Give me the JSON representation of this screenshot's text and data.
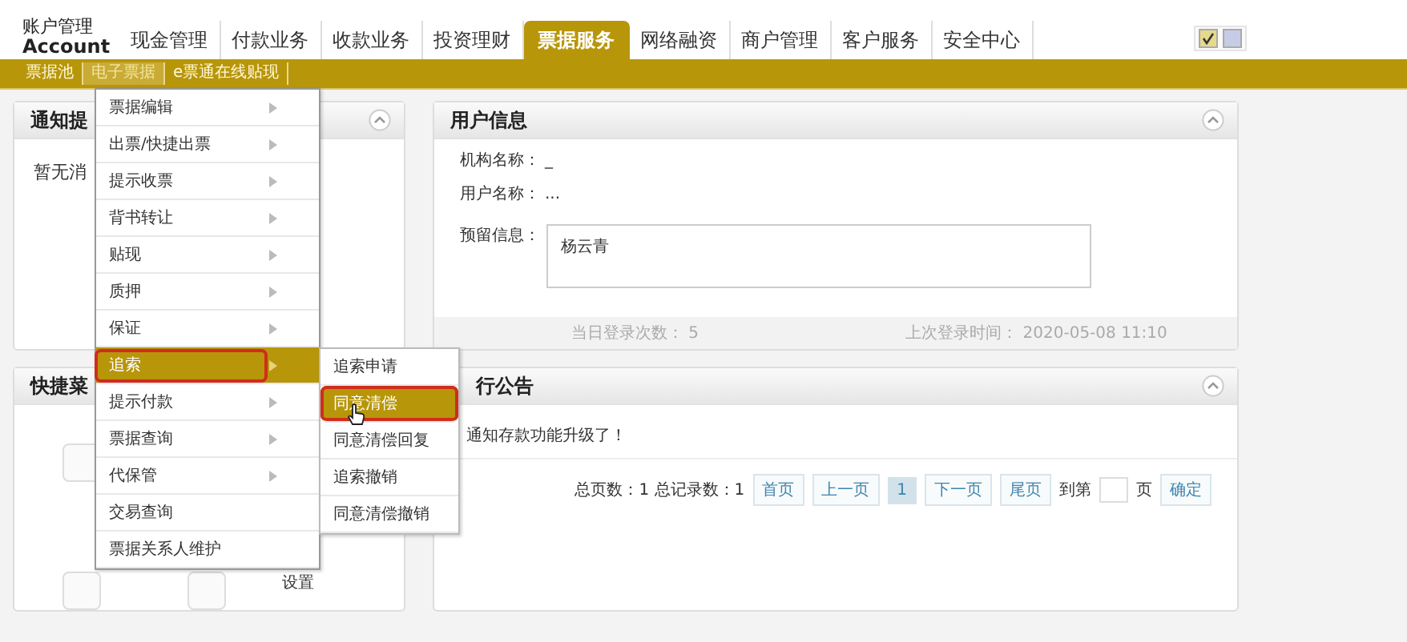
{
  "header": {
    "logo_lines": [
      "账户管理",
      "Account"
    ],
    "theme_swatches": [
      {
        "color": "#e6d98c",
        "selected": true
      },
      {
        "color": "#c6cbe6",
        "selected": false
      }
    ]
  },
  "nav_tabs": [
    {
      "label": "现金管理",
      "selected": false
    },
    {
      "label": "付款业务",
      "selected": false
    },
    {
      "label": "收款业务",
      "selected": false
    },
    {
      "label": "投资理财",
      "selected": false
    },
    {
      "label": "票据服务",
      "selected": true
    },
    {
      "label": "网络融资",
      "selected": false
    },
    {
      "label": "商户管理",
      "selected": false
    },
    {
      "label": "客户服务",
      "selected": false
    },
    {
      "label": "安全中心",
      "selected": false
    }
  ],
  "sub_nav": [
    {
      "label": "票据池",
      "selected": false
    },
    {
      "label": "电子票据",
      "selected": true
    },
    {
      "label": "e票通在线贴现",
      "selected": false
    }
  ],
  "notice_panel": {
    "title": "通知提",
    "message": "暂无消"
  },
  "user_panel": {
    "title": "用户信息",
    "fields": [
      {
        "label": "机构名称：",
        "value": "_"
      },
      {
        "label": "用户名称：",
        "value": "..."
      }
    ],
    "reserved": {
      "label": "预留信息：",
      "value": "杨云青"
    },
    "footer": [
      {
        "label": "当日登录次数：",
        "value": "5"
      },
      {
        "label": "上次登录时间：",
        "value": "2020-05-08 11:10"
      }
    ]
  },
  "quick_panel": {
    "title": "快捷菜",
    "items": [
      {
        "label": "设置"
      }
    ]
  },
  "bank_panel": {
    "title": "行公告",
    "notices": [
      "通知存款功能升级了！"
    ],
    "summary": "总页数：1 总记录数：1",
    "pager": [
      {
        "label": "首页",
        "selected": false
      },
      {
        "label": "上一页",
        "selected": false
      },
      {
        "label": "1",
        "selected": true
      },
      {
        "label": "下一页",
        "selected": false
      },
      {
        "label": "尾页",
        "selected": false
      }
    ],
    "goto_prefix": "到第",
    "goto_suffix": "页",
    "confirm": "确定"
  },
  "dropdown_menu": [
    {
      "label": "票据编辑",
      "has_submenu": true,
      "selected": false
    },
    {
      "label": "出票/快捷出票",
      "has_submenu": true,
      "selected": false
    },
    {
      "label": "提示收票",
      "has_submenu": true,
      "selected": false
    },
    {
      "label": "背书转让",
      "has_submenu": true,
      "selected": false
    },
    {
      "label": "贴现",
      "has_submenu": true,
      "selected": false
    },
    {
      "label": "质押",
      "has_submenu": true,
      "selected": false
    },
    {
      "label": "保证",
      "has_submenu": true,
      "selected": false
    },
    {
      "label": "追索",
      "has_submenu": true,
      "selected": true
    },
    {
      "label": "提示付款",
      "has_submenu": true,
      "selected": false
    },
    {
      "label": "票据查询",
      "has_submenu": true,
      "selected": false
    },
    {
      "label": "代保管",
      "has_submenu": true,
      "selected": false
    },
    {
      "label": "交易查询",
      "has_submenu": false,
      "selected": false
    },
    {
      "label": "票据关系人维护",
      "has_submenu": false,
      "selected": false
    }
  ],
  "submenu": [
    {
      "label": "追索申请",
      "selected": false
    },
    {
      "label": "同意清偿",
      "selected": true
    },
    {
      "label": "同意清偿回复",
      "selected": false
    },
    {
      "label": "追索撤销",
      "selected": false
    },
    {
      "label": "同意清偿撤销",
      "selected": false
    }
  ]
}
